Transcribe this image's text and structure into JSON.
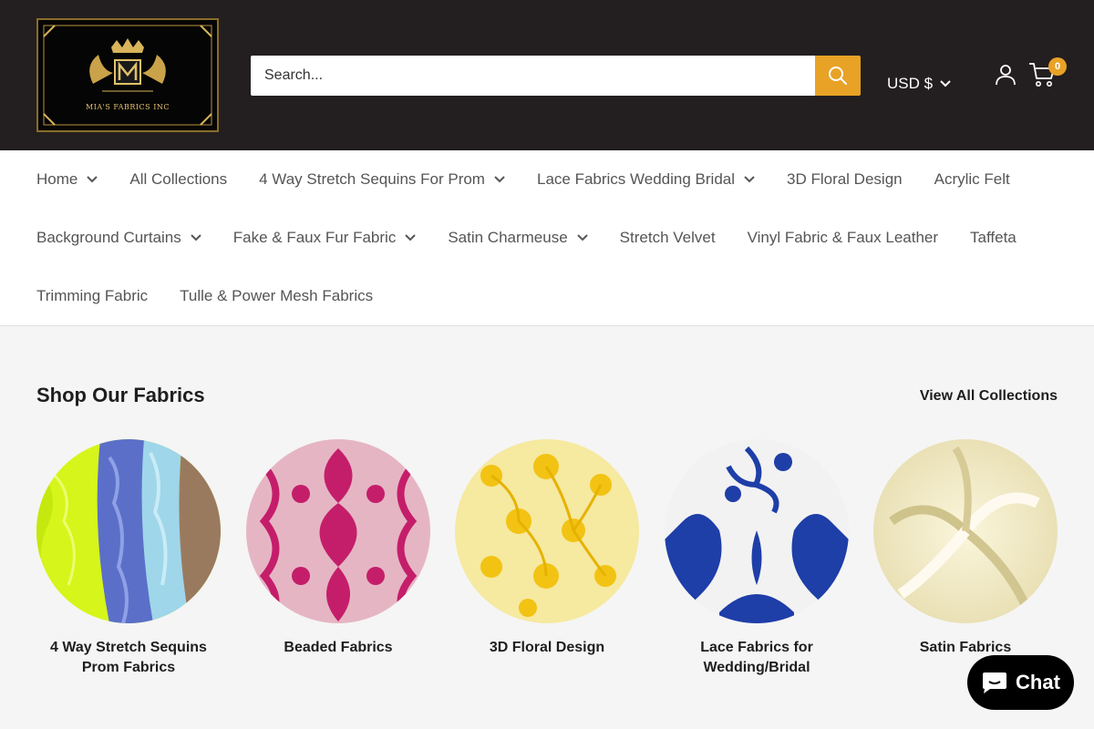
{
  "header": {
    "logo_text": "MIA'S FABRICS INC",
    "search_placeholder": "Search...",
    "currency": "USD $",
    "cart_count": "0"
  },
  "nav": {
    "rows": [
      [
        {
          "label": "Home",
          "dropdown": true
        },
        {
          "label": "All Collections",
          "dropdown": false
        },
        {
          "label": "4 Way Stretch Sequins For Prom",
          "dropdown": true
        },
        {
          "label": "Lace Fabrics Wedding Bridal",
          "dropdown": true
        },
        {
          "label": "3D Floral Design",
          "dropdown": false
        },
        {
          "label": "Acrylic Felt",
          "dropdown": false
        }
      ],
      [
        {
          "label": "Background Curtains",
          "dropdown": true
        },
        {
          "label": "Fake & Faux Fur Fabric",
          "dropdown": true
        },
        {
          "label": "Satin Charmeuse",
          "dropdown": true
        },
        {
          "label": "Stretch Velvet",
          "dropdown": false
        },
        {
          "label": "Vinyl Fabric & Faux Leather",
          "dropdown": false
        },
        {
          "label": "Taffeta",
          "dropdown": false
        }
      ],
      [
        {
          "label": "Trimming Fabric",
          "dropdown": false
        },
        {
          "label": "Tulle & Power Mesh Fabrics",
          "dropdown": false
        }
      ]
    ]
  },
  "section": {
    "title": "Shop Our Fabrics",
    "view_all": "View All Collections"
  },
  "collections": [
    {
      "label": "4 Way Stretch Sequins Prom Fabrics",
      "image": "sequins-fabric-image"
    },
    {
      "label": "Beaded Fabrics",
      "image": "beaded-fabric-image"
    },
    {
      "label": "3D Floral Design",
      "image": "floral-fabric-image"
    },
    {
      "label": "Lace Fabrics for Wedding/Bridal",
      "image": "lace-fabric-image"
    },
    {
      "label": "Satin Fabrics",
      "image": "satin-fabric-image"
    }
  ],
  "chat": {
    "label": "Chat"
  },
  "colors": {
    "header_bg": "#231f20",
    "accent": "#e8a226",
    "page_bg": "#f5f5f5"
  }
}
